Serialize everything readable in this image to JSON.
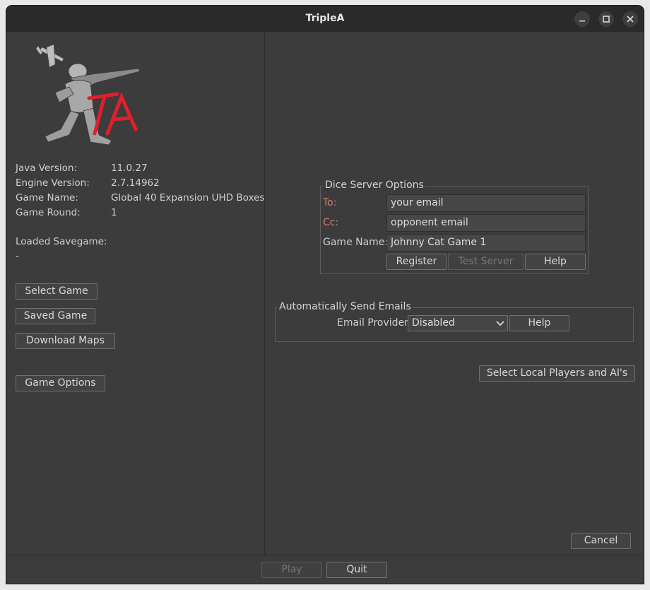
{
  "window": {
    "title": "TripleA"
  },
  "info": {
    "java_version_label": "Java Version:",
    "java_version": "11.0.27",
    "engine_version_label": "Engine Version:",
    "engine_version": "2.7.14962",
    "game_name_label": "Game Name:",
    "game_name": "Global 40 Expansion UHD Boxes",
    "game_round_label": "Game Round:",
    "game_round": "1",
    "loaded_savegame_label": "Loaded Savegame:",
    "loaded_savegame": "-"
  },
  "left_buttons": {
    "select_game": "Select Game",
    "saved_game": "Saved Game",
    "download_maps": "Download Maps",
    "game_options": "Game Options"
  },
  "dice_server": {
    "legend": "Dice Server Options",
    "to_label": "To:",
    "to_value": "your email",
    "cc_label": "Cc:",
    "cc_value": "opponent email",
    "game_name_label": "Game Name:",
    "game_name_value": "Johnny Cat Game 1",
    "register": "Register",
    "test_server": "Test Server",
    "help": "Help"
  },
  "emails": {
    "legend": "Automatically Send Emails",
    "provider_label": "Email Provider",
    "provider_value": "Disabled",
    "help": "Help"
  },
  "select_local_players": "Select Local Players and AI's",
  "cancel": "Cancel",
  "bottom": {
    "play": "Play",
    "quit": "Quit"
  },
  "colors": {
    "accent_red": "#e0202a",
    "warn_label": "#d97a74"
  }
}
